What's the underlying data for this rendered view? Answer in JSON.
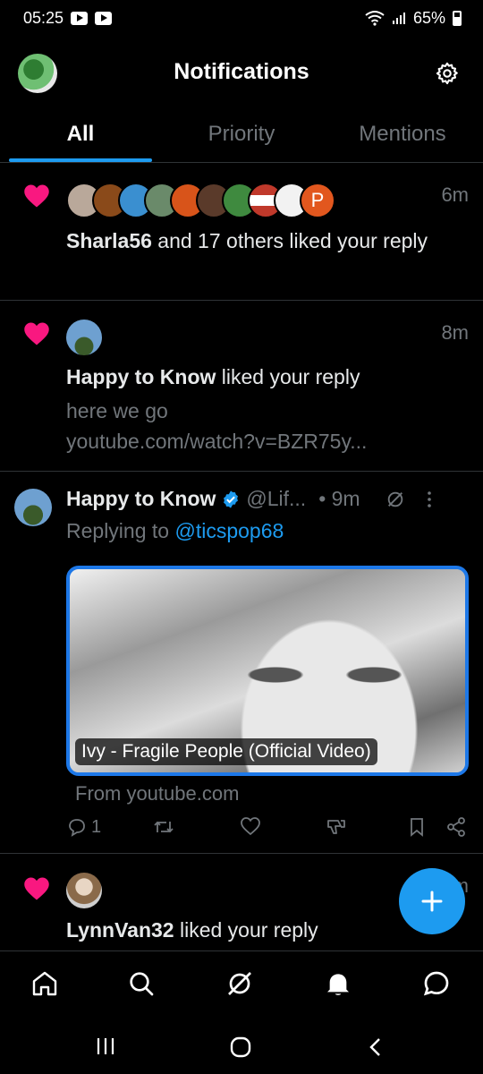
{
  "status_bar": {
    "time": "05:25",
    "battery": "65%"
  },
  "header": {
    "title": "Notifications"
  },
  "tabs": [
    {
      "label": "All"
    },
    {
      "label": "Priority"
    },
    {
      "label": "Mentions"
    }
  ],
  "notifications": [
    {
      "time": "6m",
      "actor": "Sharla56",
      "action": " and 17 others liked your reply"
    },
    {
      "time": "8m",
      "actor": "Happy to Know",
      "action": " liked your reply",
      "preview_1": "here we go",
      "preview_2": "youtube.com/watch?v=BZR75y..."
    },
    {
      "time": "m",
      "actor": "LynnVan32",
      "action": " liked your reply"
    }
  ],
  "avatar_strip_badge": "P",
  "tweet": {
    "name": "Happy to Know",
    "handle": "@Lif...",
    "time": "• 9m",
    "replying_prefix": "Replying to ",
    "replying_to": "@ticspop68",
    "media_caption": "Ivy - Fragile People (Official Video)",
    "from_source": "From youtube.com",
    "reply_count": "1"
  },
  "colors": {
    "accent": "#1d9bf0",
    "heart": "#f91880",
    "muted": "#71767b",
    "background": "#000000"
  }
}
